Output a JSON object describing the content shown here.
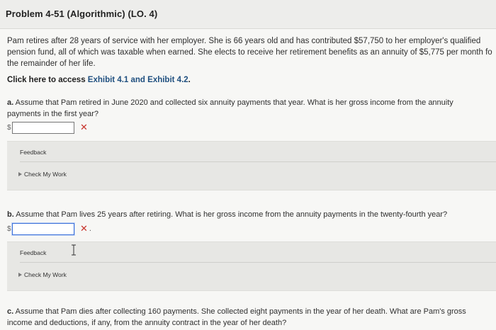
{
  "problem": {
    "title": "Problem 4-51 (Algorithmic) (LO. 4)",
    "paragraph_lines": [
      "Pam retires after 28 years of service with her employer. She is 66 years old and has contributed $57,750 to her employer's qualified",
      "pension fund, all of which was taxable when earned. She elects to receive her retirement benefits as an annuity of $5,775 per month fo",
      "the remainder of her life."
    ],
    "exhibit_prefix": "Click here to access ",
    "exhibit_link": "Exhibit 4.1 and Exhibit 4.2",
    "exhibit_suffix": "."
  },
  "questions": {
    "a": {
      "letter": "a.",
      "lines": [
        " Assume that Pam retired in June 2020 and collected six annuity payments that year. What is her gross income from the annuity",
        "payments in the first year?"
      ],
      "currency": "$",
      "value": "",
      "status": "✕"
    },
    "b": {
      "letter": "b.",
      "lines": [
        " Assume that Pam lives 25 years after retiring. What is her gross income from the annuity payments in the twenty-fourth year?"
      ],
      "currency": "$",
      "value": "",
      "status": "✕",
      "status_suffix": "."
    },
    "c": {
      "letter": "c.",
      "lines": [
        " Assume that Pam dies after collecting 160 payments. She collected eight payments in the year of her death. What are Pam's gross",
        "income and deductions, if any, from the annuity contract in the year of her death?"
      ]
    }
  },
  "feedback": {
    "label": "Feedback",
    "check_label": "Check My Work"
  },
  "colors": {
    "error": "#c8332b",
    "link": "#1f4f7f",
    "focus": "#3a6fd8"
  },
  "icons": {
    "check_toggle": "triangle-right-icon",
    "cursor": "text-cursor-icon"
  }
}
